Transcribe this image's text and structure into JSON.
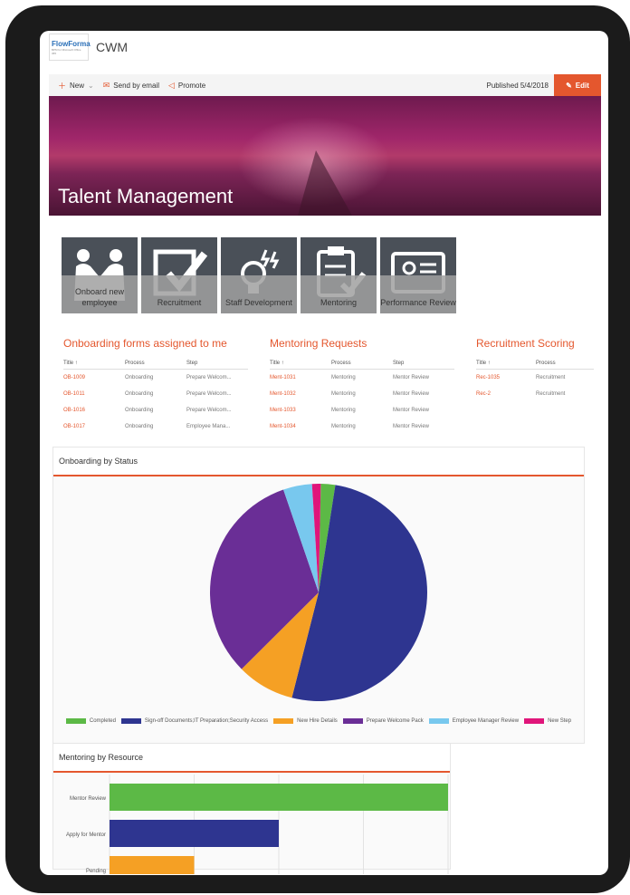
{
  "app": {
    "logo_text": "FlowForma",
    "logo_subtext": "BPM for Microsoft Office 365",
    "site_title": "CWM"
  },
  "commandbar": {
    "new_label": "New",
    "send_label": "Send by email",
    "promote_label": "Promote",
    "published_label": "Published 5/4/2018",
    "edit_label": "Edit"
  },
  "hero": {
    "title": "Talent Management"
  },
  "tiles": [
    {
      "label": "Onboard new employee",
      "icon": "handshake-icon"
    },
    {
      "label": "Recruitment",
      "icon": "checkbox-icon"
    },
    {
      "label": "Staff Development",
      "icon": "lightbulb-icon"
    },
    {
      "label": "Mentoring",
      "icon": "clipboard-icon"
    },
    {
      "label": "Performance Review",
      "icon": "id-card-icon"
    }
  ],
  "onboarding": {
    "title": "Onboarding forms assigned to me",
    "headers": [
      "Title ↑",
      "Process",
      "Step"
    ],
    "rows": [
      [
        "OB-1009",
        "Onboarding",
        "Prepare Welcom..."
      ],
      [
        "OB-1011",
        "Onboarding",
        "Prepare Welcom..."
      ],
      [
        "OB-1016",
        "Onboarding",
        "Prepare Welcom..."
      ],
      [
        "OB-1017",
        "Onboarding",
        "Employee Mana..."
      ]
    ]
  },
  "mentoring": {
    "title": "Mentoring Requests",
    "headers": [
      "Title ↑",
      "Process",
      "Step"
    ],
    "rows": [
      [
        "Ment-1031",
        "Mentoring",
        "Mentor Review"
      ],
      [
        "Ment-1032",
        "Mentoring",
        "Mentor Review"
      ],
      [
        "Ment-1033",
        "Mentoring",
        "Mentor Review"
      ],
      [
        "Ment-1034",
        "Mentoring",
        "Mentor Review"
      ]
    ]
  },
  "recruitment": {
    "title": "Recruitment Scoring",
    "headers": [
      "Title ↑",
      "Process"
    ],
    "rows": [
      [
        "Rec-1035",
        "Recruitment"
      ],
      [
        "Rec-2",
        "Recruitment"
      ]
    ]
  },
  "colors": {
    "accent": "#e4572e",
    "completed": "#5cb946",
    "signoff": "#2e3590",
    "newhire": "#f5a024",
    "welcome": "#6a2e96",
    "empmgr": "#78c8ee",
    "newstep": "#e0157a"
  },
  "chart_data": [
    {
      "type": "pie",
      "title": "Onboarding by Status",
      "series": [
        {
          "name": "Completed",
          "value": 1
        },
        {
          "name": "Sign-off Documents;IT Preparation;Security Access",
          "value": 24
        },
        {
          "name": "New Hire Details",
          "value": 4
        },
        {
          "name": "Prepare Welcome Pack",
          "value": 15
        },
        {
          "name": "Employee Manager Review",
          "value": 2
        },
        {
          "name": "New Step",
          "value": 0.6
        }
      ],
      "legend": "bottom"
    },
    {
      "type": "bar",
      "orientation": "horizontal",
      "title": "Mentoring by Resource",
      "categories": [
        "Mentor Review",
        "Apply for Mentor",
        "Pending"
      ],
      "values": [
        4,
        2,
        1
      ],
      "xlim": [
        0,
        4
      ],
      "grid": true
    }
  ]
}
